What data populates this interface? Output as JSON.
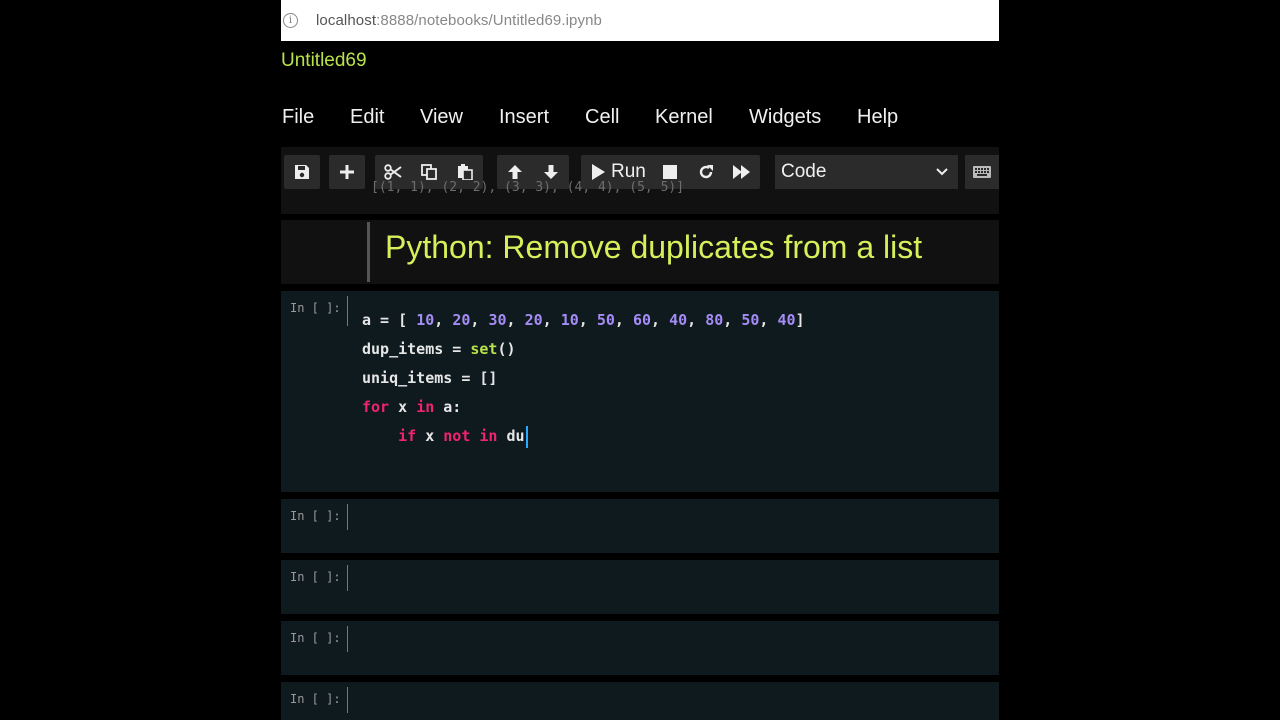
{
  "browser": {
    "url_host": "localhost",
    "url_path": ":8888/notebooks/Untitled69.ipynb"
  },
  "notebook": {
    "title": "Untitled69"
  },
  "menu": [
    "File",
    "Edit",
    "View",
    "Insert",
    "Cell",
    "Kernel",
    "Widgets",
    "Help"
  ],
  "toolbar": {
    "icons": [
      "save-icon",
      "plus-icon",
      "cut-icon",
      "copy-icon",
      "paste-icon",
      "arrow-up-icon",
      "arrow-down-icon",
      "run-icon",
      "stop-icon",
      "restart-icon",
      "fast-forward-icon",
      "keyboard-icon"
    ],
    "run_label": "Run",
    "cell_type": "Code"
  },
  "cells": {
    "partial_output": "[(1, 1), (2, 2), (3, 3), (4, 4), (5, 5)]",
    "markdown_heading": "Python: Remove duplicates from a list",
    "prompt": "In [ ]:",
    "code_lines": {
      "l1_var": "a",
      "l1_op": " = [ ",
      "l1_nums": [
        "10",
        "20",
        "30",
        "20",
        "10",
        "50",
        "60",
        "40",
        "80",
        "50",
        "40"
      ],
      "l1_close": "]",
      "l2_var": "dup_items = ",
      "l2_fn": "set",
      "l2_tail": "()",
      "l3": "uniq_items = []",
      "l4_kw1": "for",
      "l4_mid": " x ",
      "l4_kw2": "in",
      "l4_tail": " a:",
      "l5_indent": "    ",
      "l5_kw1": "if",
      "l5_mid": " x ",
      "l5_kw2": "not",
      "l5_kw3": "in",
      "l5_tail": "du"
    }
  },
  "colors": {
    "accent_green": "#b8e34a",
    "number_purple": "#a58cf5",
    "keyword_pink": "#f0246e",
    "cursor_blue": "#29a9ff"
  }
}
